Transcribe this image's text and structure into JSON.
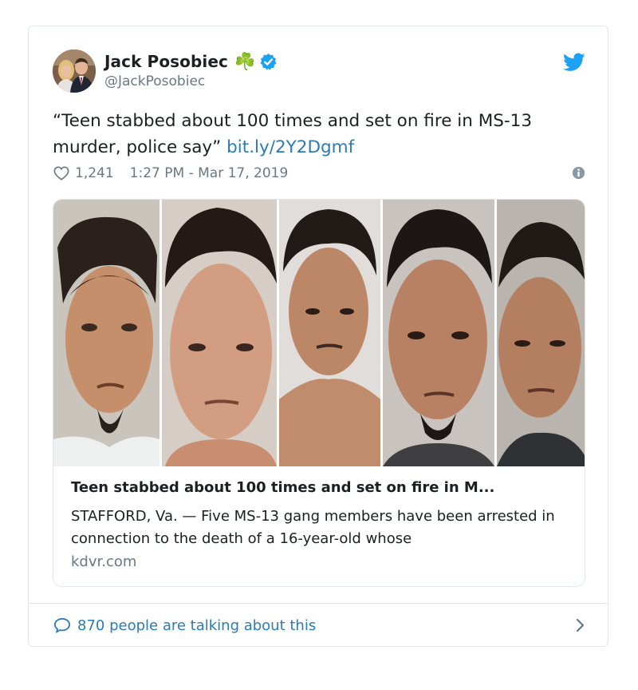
{
  "author": {
    "name": "Jack Posobiec",
    "emoji": "☘️",
    "handle": "@JackPosobiec"
  },
  "tweet": {
    "text": "“Teen stabbed about 100 times and set on fire in MS-13 murder, police say”",
    "link_text": "bit.ly/2Y2Dgmf"
  },
  "meta": {
    "like_count": "1,241",
    "timestamp": "1:27 PM - Mar 17, 2019"
  },
  "card": {
    "title": "Teen stabbed about 100 times and set on fire in M...",
    "description": "STAFFORD, Va. — Five MS-13 gang members have been arrested in connection to the death of a 16-year-old whose",
    "domain": "kdvr.com"
  },
  "footer": {
    "conversation_text": "870 people are talking about this"
  },
  "icons": {
    "heart": "heart-icon",
    "info": "info-icon",
    "verified": "verified-badge-icon",
    "twitter": "twitter-bird-icon",
    "bubble": "speech-bubble-icon",
    "chevron": "chevron-right-icon"
  },
  "colors": {
    "link": "#2b7bb9",
    "twitter_blue": "#1da1f2",
    "text_primary": "#1c2022",
    "text_secondary": "#697882",
    "border": "#e1e8ed",
    "shamrock_green": "#4aa146"
  }
}
